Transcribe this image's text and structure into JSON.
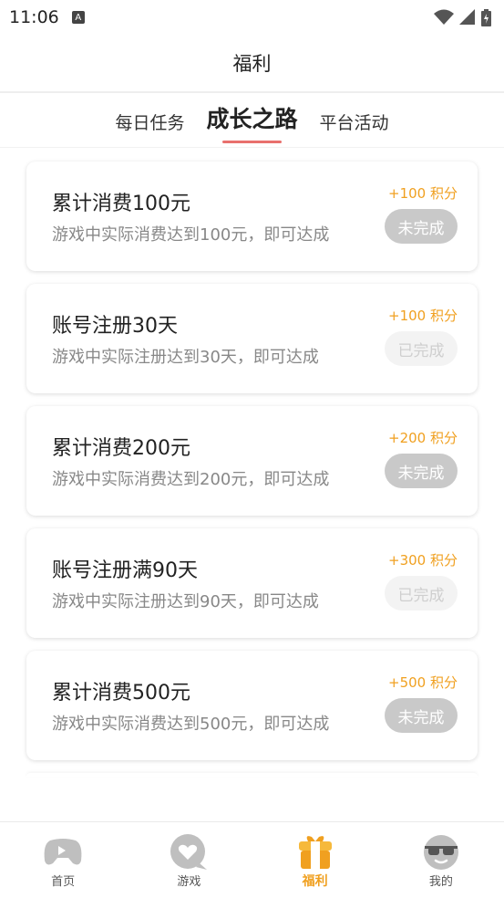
{
  "status_bar": {
    "time": "11:06",
    "notif_letter": "A"
  },
  "header": {
    "title": "福利"
  },
  "tabs": [
    {
      "label": "每日任务",
      "active": false
    },
    {
      "label": "成长之路",
      "active": true
    },
    {
      "label": "平台活动",
      "active": false
    }
  ],
  "tasks": [
    {
      "title": "累计消费100元",
      "desc": "游戏中实际消费达到100元，即可达成",
      "points": "+100 积分",
      "status": "未完成"
    },
    {
      "title": "账号注册30天",
      "desc": "游戏中实际注册达到30天，即可达成",
      "points": "+100 积分",
      "status": "已完成"
    },
    {
      "title": "累计消费200元",
      "desc": "游戏中实际消费达到200元，即可达成",
      "points": "+200 积分",
      "status": "未完成"
    },
    {
      "title": "账号注册满90天",
      "desc": "游戏中实际注册达到90天，即可达成",
      "points": "+300 积分",
      "status": "已完成"
    },
    {
      "title": "累计消费500元",
      "desc": "游戏中实际消费达到500元，即可达成",
      "points": "+500 积分",
      "status": "未完成"
    }
  ],
  "bottom_nav": [
    {
      "label": "首页",
      "icon": "gamepad-icon",
      "active": false
    },
    {
      "label": "游戏",
      "icon": "heart-chat-icon",
      "active": false
    },
    {
      "label": "福利",
      "icon": "gift-icon",
      "active": true
    },
    {
      "label": "我的",
      "icon": "sunglasses-face-icon",
      "active": false
    }
  ],
  "colors": {
    "accent": "#f0a020",
    "tab_underline": "#e8706d"
  }
}
